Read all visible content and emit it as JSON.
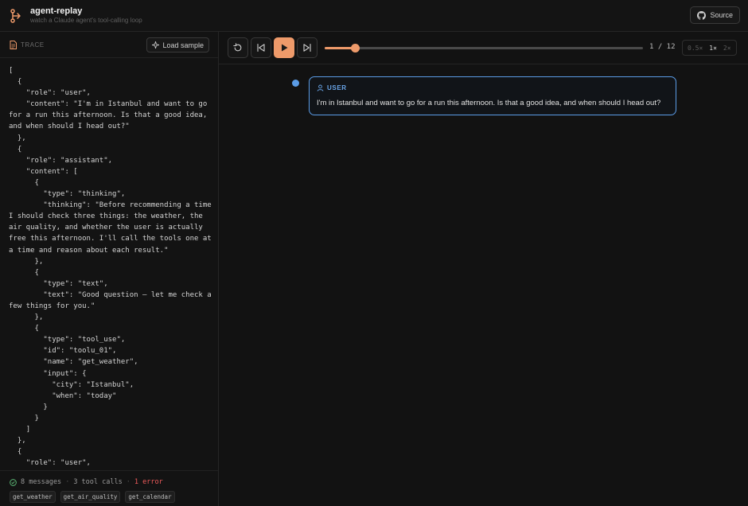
{
  "app": {
    "title": "agent-replay",
    "subtitle": "watch a Claude agent's tool-calling loop",
    "source_label": "Source"
  },
  "trace": {
    "label": "TRACE",
    "load_label": "Load sample",
    "json_text": "[\n  {\n    \"role\": \"user\",\n    \"content\": \"I'm in Istanbul and want to go for a run this afternoon. Is that a good idea, and when should I head out?\"\n  },\n  {\n    \"role\": \"assistant\",\n    \"content\": [\n      {\n        \"type\": \"thinking\",\n        \"thinking\": \"Before recommending a time I should check three things: the weather, the air quality, and whether the user is actually free this afternoon. I'll call the tools one at a time and reason about each result.\"\n      },\n      {\n        \"type\": \"text\",\n        \"text\": \"Good question — let me check a few things for you.\"\n      },\n      {\n        \"type\": \"tool_use\",\n        \"id\": \"toolu_01\",\n        \"name\": \"get_weather\",\n        \"input\": {\n          \"city\": \"Istanbul\",\n          \"when\": \"today\"\n        }\n      }\n    ]\n  },\n  {\n    \"role\": \"user\",",
    "summary": {
      "messages": "8 messages",
      "tool_calls": "3 tool calls",
      "errors": "1 error",
      "separator": "·"
    },
    "tools": [
      "get_weather",
      "get_air_quality",
      "get_calendar"
    ]
  },
  "player": {
    "step_text": "1 / 12",
    "progress": 0.095,
    "speeds": [
      "0.5×",
      "1×",
      "2×"
    ],
    "active_speed": "1×",
    "icons": [
      "restart-icon",
      "step-back-icon",
      "play-icon",
      "step-forward-icon"
    ]
  },
  "message": {
    "role_label": "USER",
    "text": "I'm in Istanbul and want to go for a run this afternoon. Is that a good idea, and when should I head out?"
  },
  "colors": {
    "accent": "#ee9a6a",
    "user": "#5b9ce6",
    "error": "#ef5b5b",
    "success": "#5fbf7a"
  }
}
